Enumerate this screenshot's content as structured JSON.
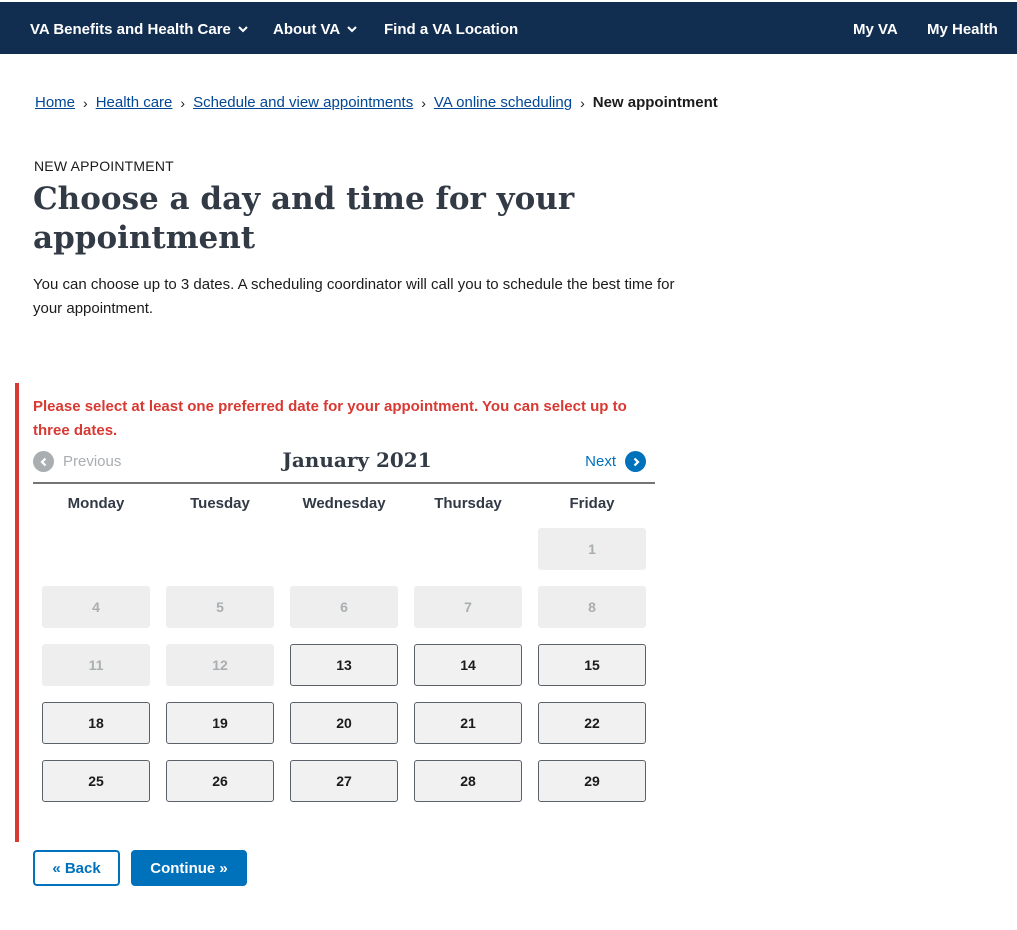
{
  "nav": {
    "benefits": "VA Benefits and Health Care",
    "about": "About VA",
    "find": "Find a VA Location",
    "my_va": "My VA",
    "my_health": "My Health"
  },
  "breadcrumb": {
    "items": [
      "Home",
      "Health care",
      "Schedule and view appointments",
      "VA online scheduling"
    ],
    "current": "New appointment",
    "separator": "›"
  },
  "page": {
    "eyebrow": "NEW APPOINTMENT",
    "title": "Choose a day and time for your appointment",
    "intro": "You can choose up to 3 dates. A scheduling coordinator will call you to schedule the best time for your appointment."
  },
  "error": {
    "message": "Please select at least one preferred date for your appointment. You can select up to three dates."
  },
  "calendar": {
    "month": "January 2021",
    "prev_label": "Previous",
    "next_label": "Next",
    "weekdays": [
      "Monday",
      "Tuesday",
      "Wednesday",
      "Thursday",
      "Friday"
    ],
    "weeks": [
      [
        null,
        null,
        null,
        null,
        {
          "day": "1",
          "available": false
        }
      ],
      [
        {
          "day": "4",
          "available": false
        },
        {
          "day": "5",
          "available": false
        },
        {
          "day": "6",
          "available": false
        },
        {
          "day": "7",
          "available": false
        },
        {
          "day": "8",
          "available": false
        }
      ],
      [
        {
          "day": "11",
          "available": false
        },
        {
          "day": "12",
          "available": false
        },
        {
          "day": "13",
          "available": true
        },
        {
          "day": "14",
          "available": true
        },
        {
          "day": "15",
          "available": true
        }
      ],
      [
        {
          "day": "18",
          "available": true
        },
        {
          "day": "19",
          "available": true
        },
        {
          "day": "20",
          "available": true
        },
        {
          "day": "21",
          "available": true
        },
        {
          "day": "22",
          "available": true
        }
      ],
      [
        {
          "day": "25",
          "available": true
        },
        {
          "day": "26",
          "available": true
        },
        {
          "day": "27",
          "available": true
        },
        {
          "day": "28",
          "available": true
        },
        {
          "day": "29",
          "available": true
        }
      ]
    ]
  },
  "actions": {
    "back": "« Back",
    "continue": "Continue »"
  },
  "colors": {
    "nav_bg": "#112e51",
    "link": "#004795",
    "primary": "#0071bb",
    "error": "#d83933"
  }
}
